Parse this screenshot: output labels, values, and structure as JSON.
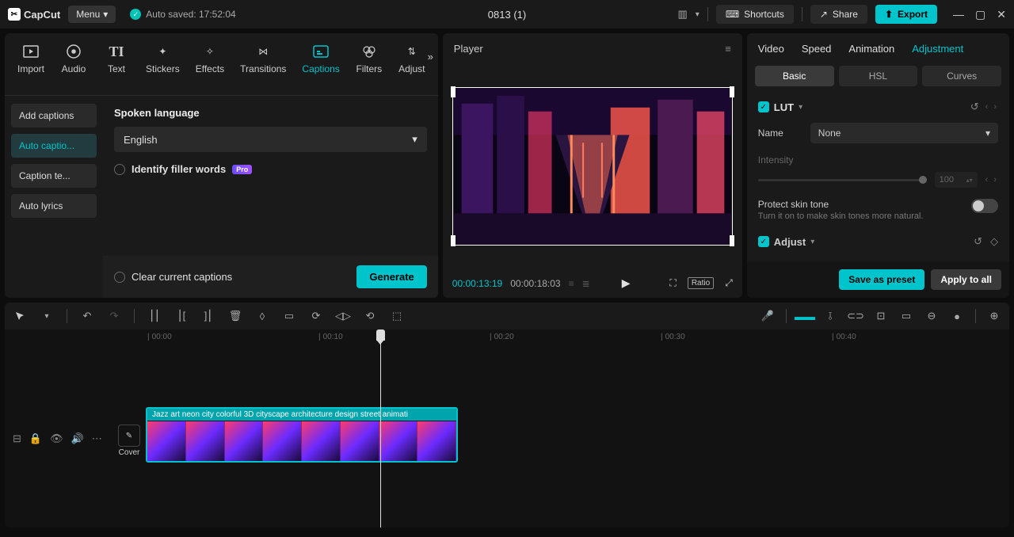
{
  "app": {
    "name": "CapCut",
    "menu": "Menu",
    "autosave": "Auto saved: 17:52:04",
    "title": "0813 (1)"
  },
  "topbar": {
    "shortcuts": "Shortcuts",
    "share": "Share",
    "export": "Export"
  },
  "mediaTabs": [
    "Import",
    "Audio",
    "Text",
    "Stickers",
    "Effects",
    "Transitions",
    "Captions",
    "Filters",
    "Adjust"
  ],
  "sidebar": {
    "items": [
      "Add captions",
      "Auto captio...",
      "Caption te...",
      "Auto lyrics"
    ]
  },
  "captions": {
    "langLabel": "Spoken language",
    "language": "English",
    "filler": "Identify filler words",
    "pro": "Pro",
    "clear": "Clear current captions",
    "generate": "Generate"
  },
  "player": {
    "title": "Player",
    "current": "00:00:13:19",
    "total": "00:00:18:03",
    "ratio": "Ratio"
  },
  "right": {
    "tabs": [
      "Video",
      "Speed",
      "Animation",
      "Adjustment"
    ],
    "subtabs": [
      "Basic",
      "HSL",
      "Curves"
    ],
    "lut": "LUT",
    "name": "Name",
    "none": "None",
    "intensity": "Intensity",
    "intensityVal": "100",
    "protectTitle": "Protect skin tone",
    "protectSub": "Turn it on to make skin tones more natural.",
    "adjust": "Adjust",
    "savePreset": "Save as preset",
    "applyAll": "Apply to all"
  },
  "ruler": {
    "marks": [
      "00:00",
      "00:10",
      "00:20",
      "00:30",
      "00:40"
    ]
  },
  "clip": {
    "title": "Jazz art neon city colorful 3D cityscape architecture design street animati"
  },
  "cover": "Cover"
}
